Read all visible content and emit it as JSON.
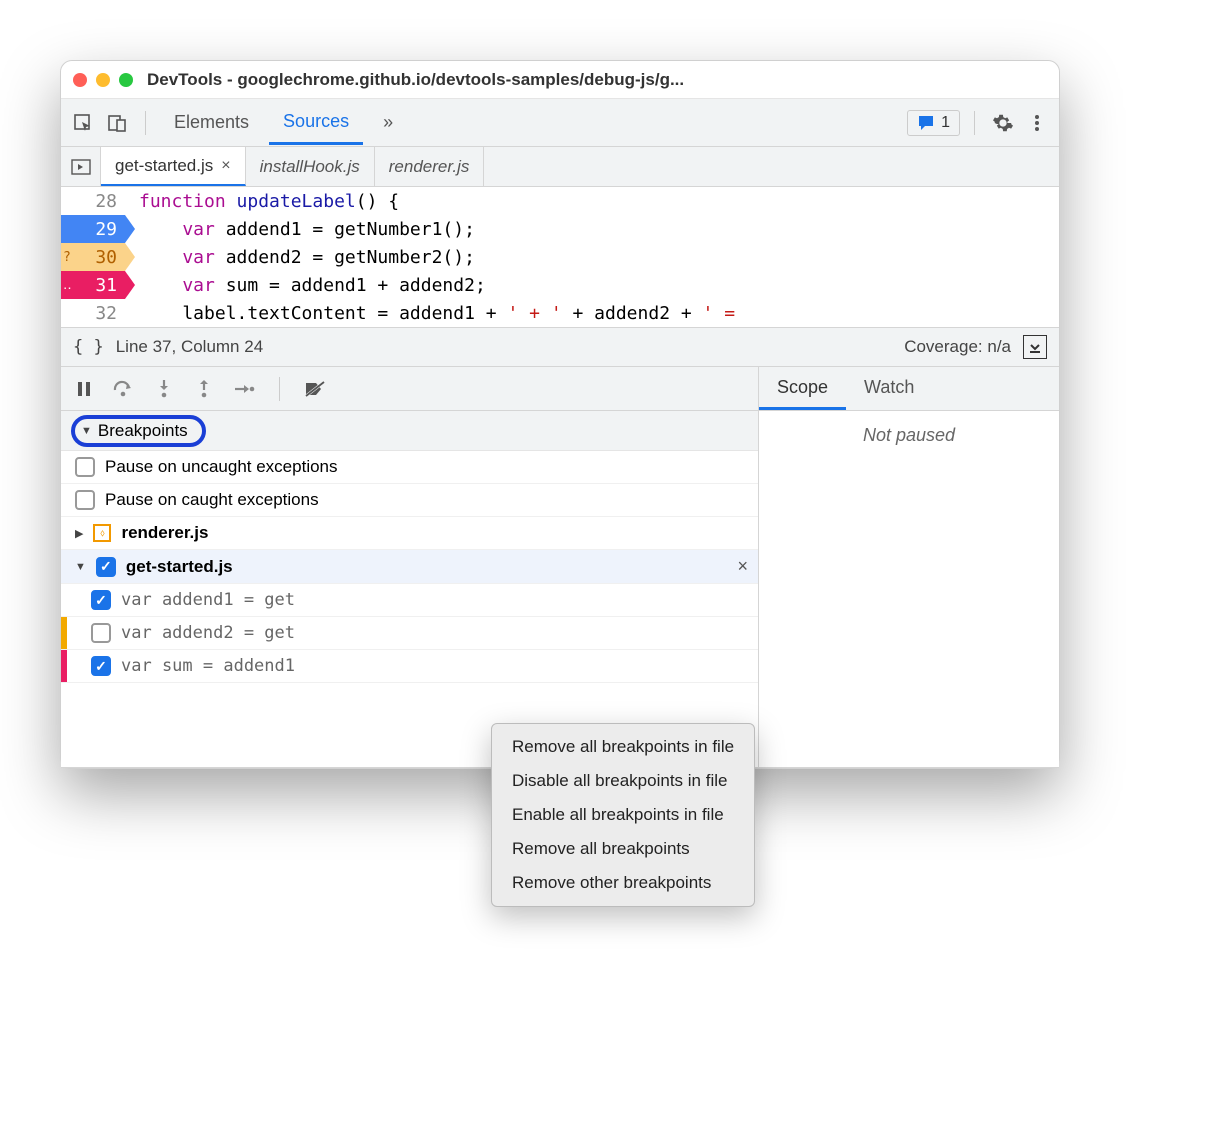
{
  "window": {
    "title": "DevTools - googlechrome.github.io/devtools-samples/debug-js/g..."
  },
  "toolbar": {
    "tabs": {
      "elements": "Elements",
      "sources": "Sources"
    },
    "issues_count": "1"
  },
  "file_tabs": {
    "active": "get-started.js",
    "items": [
      {
        "name": "get-started.js",
        "active": true,
        "closable": true
      },
      {
        "name": "installHook.js",
        "active": false,
        "italic": true
      },
      {
        "name": "renderer.js",
        "active": false,
        "italic": true
      }
    ]
  },
  "code": {
    "lines": [
      {
        "n": "28",
        "bp": "",
        "marker": ""
      },
      {
        "n": "29",
        "bp": "blue",
        "marker": ""
      },
      {
        "n": "30",
        "bp": "orange",
        "marker": "?"
      },
      {
        "n": "31",
        "bp": "pink",
        "marker": "‥"
      },
      {
        "n": "32",
        "bp": "",
        "marker": ""
      }
    ],
    "l28_kw": "function",
    "l28_fn": " updateLabel",
    "l28_rest": "() {",
    "l29": "    var",
    "l29b": " addend1 = getNumber1();",
    "l30": "    var",
    "l30b": " addend2 = getNumber2();",
    "l31": "    var",
    "l31b": " sum = addend1 + addend2;",
    "l32a": "    label.textContent = addend1 + ",
    "l32s1": "' + '",
    "l32b": " + addend2 + ",
    "l32s2": "' ="
  },
  "status": {
    "cursor": "Line 37, Column 24",
    "coverage": "Coverage: n/a"
  },
  "breakpoints": {
    "header": "Breakpoints",
    "pause_uncaught": "Pause on uncaught exceptions",
    "pause_caught": "Pause on caught exceptions",
    "files": [
      {
        "name": "renderer.js",
        "expanded": false,
        "checked": null
      },
      {
        "name": "get-started.js",
        "expanded": true,
        "checked": true
      }
    ],
    "items": [
      {
        "text": "var addend1 = get",
        "checked": true,
        "color": ""
      },
      {
        "text": "var addend2 = get",
        "checked": false,
        "color": "orange"
      },
      {
        "text": "var sum = addend1",
        "checked": true,
        "color": "pink"
      }
    ]
  },
  "right_panel": {
    "tabs": {
      "scope": "Scope",
      "watch": "Watch"
    },
    "status": "Not paused"
  },
  "context_menu": [
    "Remove all breakpoints in file",
    "Disable all breakpoints in file",
    "Enable all breakpoints in file",
    "Remove all breakpoints",
    "Remove other breakpoints"
  ]
}
